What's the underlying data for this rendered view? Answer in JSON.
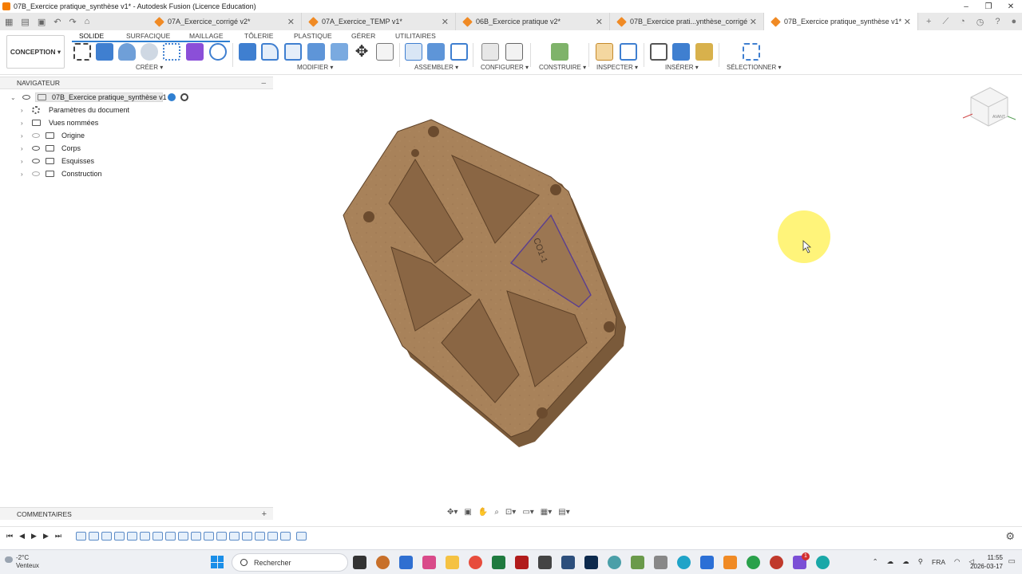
{
  "window": {
    "title": "07B_Exercice pratique_synthèse v1* - Autodesk Fusion (Licence Education)",
    "min": "–",
    "max": "❐",
    "close": "✕"
  },
  "tabs": [
    {
      "label": "07A_Exercice_corrigé v2*",
      "close": "✕"
    },
    {
      "label": "07A_Exercice_TEMP v1*",
      "close": "✕"
    },
    {
      "label": "06B_Exercice pratique v2*",
      "close": "✕"
    },
    {
      "label": "07B_Exercice prati...ynthèse_corrigé v1",
      "close": "✕"
    },
    {
      "label": "07B_Exercice pratique_synthèse v1*",
      "close": "✕"
    }
  ],
  "toolbar": {
    "workspace": "CONCEPTION ▾",
    "workspace_tabs": [
      "SOLIDE",
      "SURFACIQUE",
      "MAILLAGE",
      "TÔLERIE",
      "PLASTIQUE",
      "GÉRER",
      "UTILITAIRES"
    ],
    "groups": [
      "CRÉER ▾",
      "MODIFIER ▾",
      "ASSEMBLER ▾",
      "CONFIGURER ▾",
      "CONSTRUIRE ▾",
      "INSPECTER ▾",
      "INSÉRER ▾",
      "SÉLECTIONNER ▾"
    ]
  },
  "navigator": {
    "header": "NAVIGATEUR",
    "root": "07B_Exercice pratique_synthèse v1",
    "items": [
      "Paramètres du document",
      "Vues nommées",
      "Origine",
      "Corps",
      "Esquisses",
      "Construction"
    ]
  },
  "viewport": {
    "sketch_label": "CO1-1",
    "viewcube_label": "AVANT"
  },
  "comments": {
    "label": "COMMENTAIRES",
    "add": "+"
  },
  "taskbar": {
    "temperature": "-2°C",
    "weather": "Venteux",
    "search_placeholder": "Rechercher",
    "language": "FRA",
    "time": "11:55",
    "date": "2026-03-17",
    "notification_count": "1"
  },
  "colors": {
    "accent": "#f08a24",
    "wood": "#a27a4f",
    "sketch": "#5b3f8f",
    "cursor_highlight": "#fff36b"
  }
}
